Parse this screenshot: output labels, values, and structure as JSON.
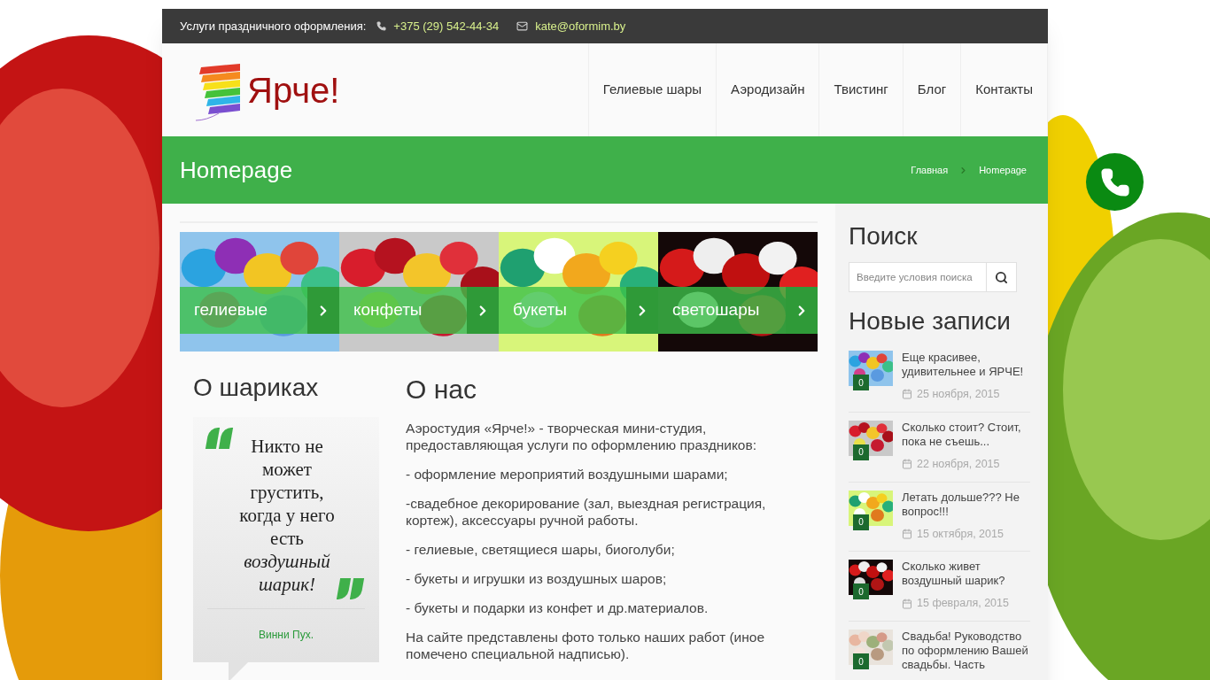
{
  "topbar": {
    "label": "Услуги праздничного оформления:",
    "phone": "+375 (29) 542-44-34",
    "email": "kate@oformim.by"
  },
  "logo": {
    "text": "Ярче!"
  },
  "nav": [
    {
      "label": "Гелиевые шары"
    },
    {
      "label": "Аэродизайн"
    },
    {
      "label": "Твистинг"
    },
    {
      "label": "Блог"
    },
    {
      "label": "Контакты"
    }
  ],
  "page_title": "Homepage",
  "breadcrumbs": [
    "Главная",
    "Homepage"
  ],
  "categories": [
    {
      "label": "гелиевые"
    },
    {
      "label": "конфеты"
    },
    {
      "label": "букеты"
    },
    {
      "label": "светошары"
    }
  ],
  "quote_section": {
    "title": "О шариках",
    "quote": "Никто не может грустить, когда у него есть *воздушный шарик!*",
    "author": "Винни Пух."
  },
  "about": {
    "title": "О нас",
    "paragraphs": [
      "Аэростудия «Ярче!» - творческая мини-студия, предоставляющая услуги по оформлению праздников:",
      "- оформление мероприятий воздушными шарами;",
      "-свадебное декорирование (зал, выездная регистрация, кортеж), аксессуары ручной работы.",
      "- гелиевые, светящиеся шары, биоголуби;",
      "- букеты и игрушки из воздушных шаров;",
      "- букеты и подарки из конфет и др.материалов.",
      "На сайте представлены фото только наших работ (иное помечено специальной надписью)."
    ]
  },
  "search": {
    "title": "Поиск",
    "placeholder": "Введите условия поиска"
  },
  "recent": {
    "title": "Новые записи",
    "posts": [
      {
        "title": "Еще красивее, удивительнее и ЯРЧЕ!",
        "date": "25 ноября, 2015",
        "comments": "0"
      },
      {
        "title": "Сколько стоит? Стоит, пока не съешь...",
        "date": "22 ноября, 2015",
        "comments": "0"
      },
      {
        "title": "Летать дольше??? Не вопрос!!!",
        "date": "15 октября, 2015",
        "comments": "0"
      },
      {
        "title": "Сколько живет воздушный шарик?",
        "date": "15 февраля, 2015",
        "comments": "0"
      },
      {
        "title": "Свадьба! Руководство по оформлению Вашей свадьбы. Часть",
        "comments": "0"
      }
    ]
  }
}
